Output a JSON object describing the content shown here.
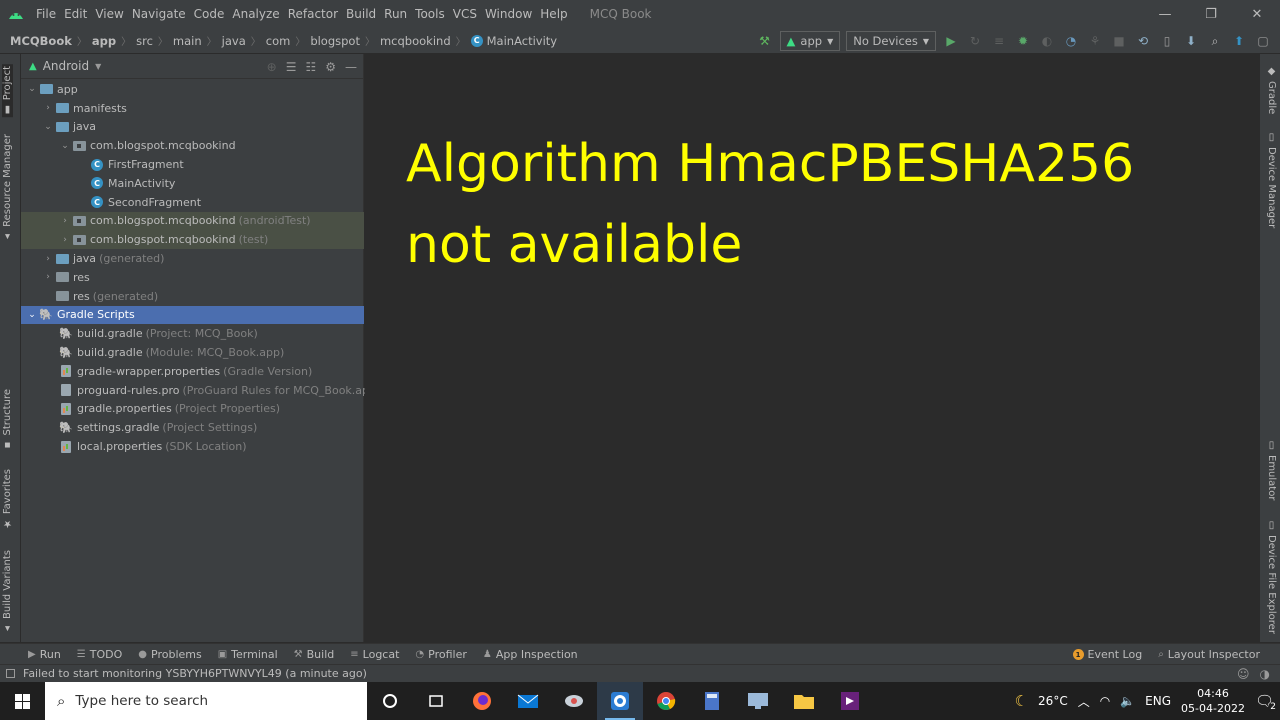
{
  "menubar": {
    "items": [
      "File",
      "Edit",
      "View",
      "Navigate",
      "Code",
      "Analyze",
      "Refactor",
      "Build",
      "Run",
      "Tools",
      "VCS",
      "Window",
      "Help"
    ],
    "window_title": "MCQ Book",
    "controls": [
      "—",
      "❐",
      "✕"
    ]
  },
  "breadcrumb": {
    "items": [
      "MCQBook",
      "app",
      "src",
      "main",
      "java",
      "com",
      "blogspot",
      "mcqbookind"
    ],
    "current": "MainActivity"
  },
  "toolbar": {
    "run_config": "app",
    "device": "No Devices"
  },
  "left_strip": {
    "tabs": [
      "Project",
      "Resource Manager",
      "Structure",
      "Favorites",
      "Build Variants"
    ]
  },
  "right_strip": {
    "tabs": [
      "Gradle",
      "Device Manager",
      "Emulator",
      "Device File Explorer"
    ]
  },
  "project_panel": {
    "view_mode": "Android",
    "tree": [
      {
        "label": "app",
        "hint": ""
      },
      {
        "label": "manifests",
        "hint": ""
      },
      {
        "label": "java",
        "hint": ""
      },
      {
        "label": "com.blogspot.mcqbookind",
        "hint": ""
      },
      {
        "label": "FirstFragment",
        "hint": ""
      },
      {
        "label": "MainActivity",
        "hint": ""
      },
      {
        "label": "SecondFragment",
        "hint": ""
      },
      {
        "label": "com.blogspot.mcqbookind",
        "hint": "(androidTest)"
      },
      {
        "label": "com.blogspot.mcqbookind",
        "hint": "(test)"
      },
      {
        "label": "java",
        "hint": "(generated)"
      },
      {
        "label": "res",
        "hint": ""
      },
      {
        "label": "res",
        "hint": "(generated)"
      },
      {
        "label": "Gradle Scripts",
        "hint": ""
      },
      {
        "label": "build.gradle",
        "hint": "(Project: MCQ_Book)"
      },
      {
        "label": "build.gradle",
        "hint": "(Module: MCQ_Book.app)"
      },
      {
        "label": "gradle-wrapper.properties",
        "hint": "(Gradle Version)"
      },
      {
        "label": "proguard-rules.pro",
        "hint": "(ProGuard Rules for MCQ_Book.app)"
      },
      {
        "label": "gradle.properties",
        "hint": "(Project Properties)"
      },
      {
        "label": "settings.gradle",
        "hint": "(Project Settings)"
      },
      {
        "label": "local.properties",
        "hint": "(SDK Location)"
      }
    ]
  },
  "editor": {
    "overlay_line1": "Algorithm HmacPBESHA256",
    "overlay_line2": "not available"
  },
  "bottom_tabs": {
    "left": [
      "Run",
      "TODO",
      "Problems",
      "Terminal",
      "Build",
      "Logcat",
      "Profiler",
      "App Inspection"
    ],
    "event_log": "Event Log",
    "event_badge": "1",
    "layout_inspector": "Layout Inspector"
  },
  "status": {
    "message": "Failed to start monitoring YSBYYH6PTWNVYL49 (a minute ago)"
  },
  "taskbar": {
    "search_placeholder": "Type here to search",
    "weather": "26°C",
    "lang": "ENG",
    "time": "04:46",
    "date": "05-04-2022",
    "notif_count": "2"
  },
  "colors": {
    "overlay_text": "#ffff00",
    "selection": "#4b6eaf",
    "test_highlight": "#4a5045"
  }
}
